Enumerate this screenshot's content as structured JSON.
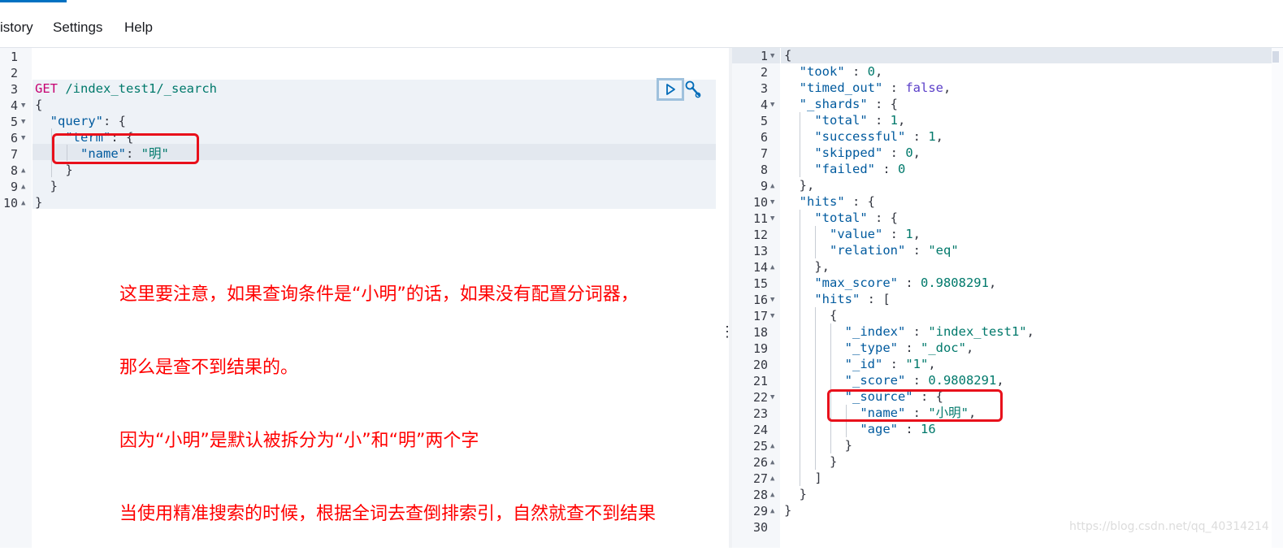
{
  "menu": {
    "history": "istory",
    "settings": "Settings",
    "help": "Help"
  },
  "request": {
    "verb": "GET",
    "path": "/index_test1/_search",
    "lines": [
      "1",
      "2",
      "3",
      "4",
      "5",
      "6",
      "7",
      "8",
      "9",
      "10"
    ],
    "query_key": "\"query\"",
    "term_key": "\"term\"",
    "name_key": "\"name\"",
    "name_value": "\"明\""
  },
  "note": {
    "line1": "这里要注意，如果查询条件是“小明”的话，如果没有配置分词器，",
    "line2": "那么是查不到结果的。",
    "line3": "因为“小明”是默认被拆分为“小”和“明”两个字",
    "line4": "当使用精准搜索的时候，根据全词去查倒排索引，自然就查不到结果"
  },
  "response": {
    "lines": [
      "1",
      "2",
      "3",
      "4",
      "5",
      "6",
      "7",
      "8",
      "9",
      "10",
      "11",
      "12",
      "13",
      "14",
      "15",
      "16",
      "17",
      "18",
      "19",
      "20",
      "21",
      "22",
      "23",
      "24",
      "25",
      "26",
      "27",
      "28",
      "29",
      "30"
    ],
    "took": "0",
    "timed_out": "false",
    "shards_total": "1",
    "shards_successful": "1",
    "shards_skipped": "0",
    "shards_failed": "0",
    "hits_total_value": "1",
    "hits_total_relation": "\"eq\"",
    "max_score": "0.9808291",
    "hit_index": "\"index_test1\"",
    "hit_type": "\"_doc\"",
    "hit_id": "\"1\"",
    "hit_score": "0.9808291",
    "source_name": "\"小明\"",
    "source_age": "16"
  },
  "icons": {
    "run": "play-icon",
    "settings": "wrench-icon"
  },
  "colors": {
    "accent": "#0071c2",
    "annotation": "#ff0000"
  },
  "watermark": "https://blog.csdn.net/qq_40314214"
}
